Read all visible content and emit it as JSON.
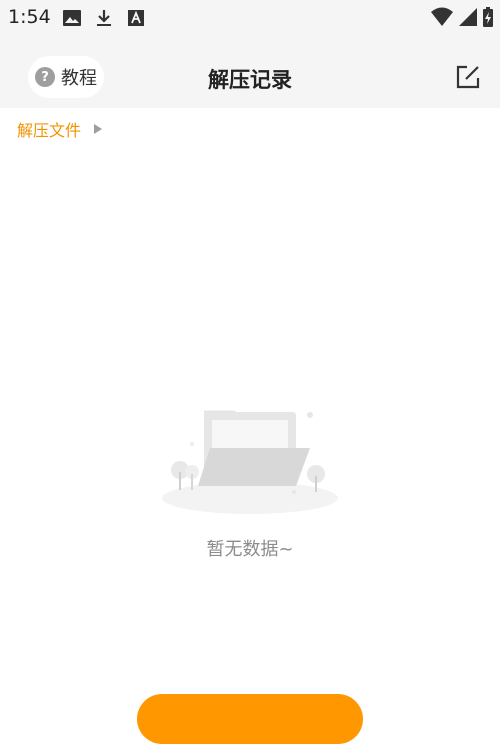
{
  "status_bar": {
    "time": "1:54",
    "left_icons": [
      "image-icon",
      "download-icon",
      "font-icon"
    ],
    "right_icons": [
      "wifi-icon",
      "signal-icon",
      "battery-icon"
    ]
  },
  "app_bar": {
    "tutorial_label": "教程",
    "help_glyph": "?",
    "title": "解压记录",
    "edit_icon": "edit-icon"
  },
  "breadcrumb": {
    "label": "解压文件",
    "arrow_icon": "play-right-icon"
  },
  "empty_state": {
    "illustration": "empty-folder-illustration",
    "message": "暂无数据~"
  },
  "colors": {
    "accent": "#f29300",
    "button": "#ff9800",
    "header_bg": "#f5f5f5",
    "muted_text": "#8c8c8c"
  }
}
